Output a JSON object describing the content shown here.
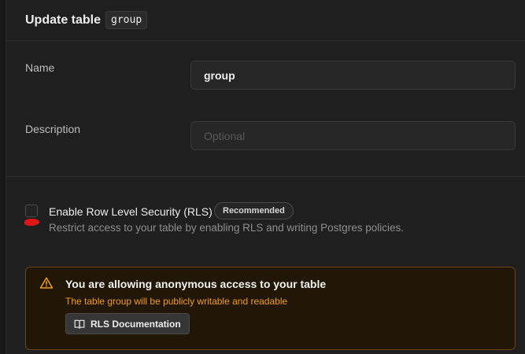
{
  "header": {
    "title": "Update table",
    "table_name": "group"
  },
  "form": {
    "name_label": "Name",
    "name_value": "group",
    "description_label": "Description",
    "description_placeholder": "Optional"
  },
  "rls": {
    "checked": false,
    "title": "Enable Row Level Security (RLS)",
    "badge": "Recommended",
    "description": "Restrict access to your table by enabling RLS and writing Postgres policies."
  },
  "warning": {
    "icon": "warning-triangle-icon",
    "title": "You are allowing anonymous access to your table",
    "text": "The table group will be publicly writable and readable",
    "button_icon": "book-open-icon",
    "button_label": "RLS Documentation",
    "accent_color": "#f29d1a"
  }
}
